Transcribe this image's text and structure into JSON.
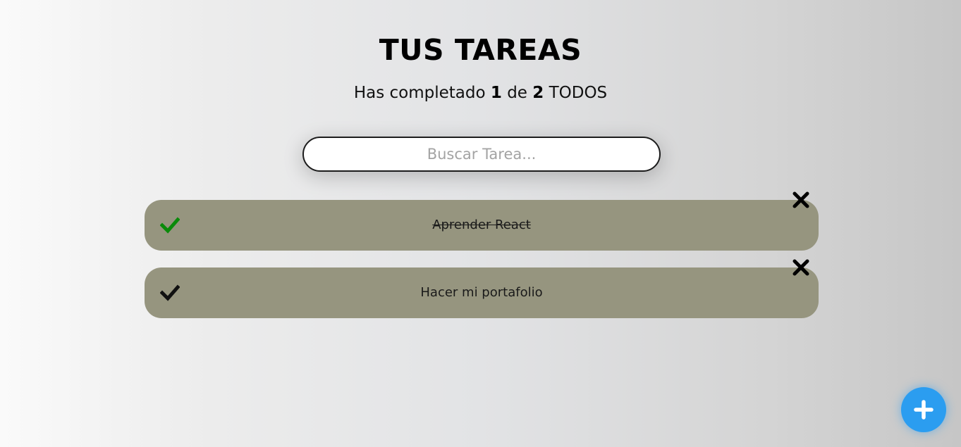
{
  "header": {
    "title": "TUS TAREAS",
    "counter": {
      "prefix": "Has completado",
      "completed": "1",
      "middle": "de",
      "total": "2",
      "suffix": "TODOS"
    }
  },
  "search": {
    "placeholder": "Buscar Tarea...",
    "value": ""
  },
  "todos": [
    {
      "text": "Aprender React",
      "completed": true,
      "check_icon": "check-icon",
      "check_color": "#0a8a0a",
      "delete_icon": "close-icon"
    },
    {
      "text": "Hacer mi portafolio",
      "completed": false,
      "check_icon": "check-icon",
      "check_color": "#111111",
      "delete_icon": "close-icon"
    }
  ],
  "add_button": {
    "icon": "plus-icon",
    "color": "#2b9df0"
  },
  "colors": {
    "todo_background": "#96957f",
    "completed_check": "#0a8a0a",
    "pending_check": "#111111"
  }
}
